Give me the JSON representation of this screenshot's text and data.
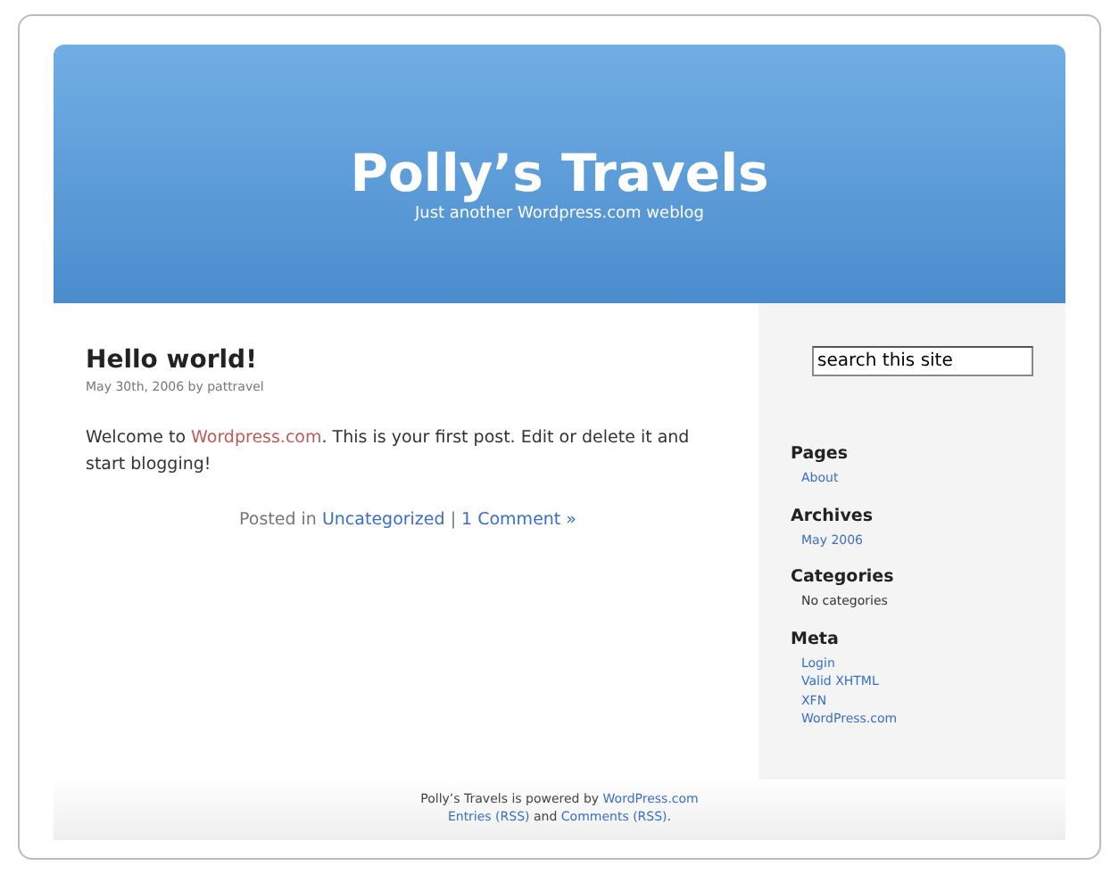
{
  "header": {
    "title": "Polly’s Travels",
    "tagline": "Just another Wordpress.com weblog"
  },
  "post": {
    "title": "Hello world!",
    "meta": "May 30th, 2006 by pattravel",
    "body": [
      {
        "text": "Welcome to ",
        "kind": "text"
      },
      {
        "text": "Wordpress.com",
        "kind": "link"
      },
      {
        "text": ". This is your first post. Edit or delete it and start blogging!",
        "kind": "text"
      }
    ],
    "footer": [
      {
        "text": "Posted in ",
        "kind": "text"
      },
      {
        "text": "Uncategorized",
        "kind": "link"
      },
      {
        "text": " | ",
        "kind": "text"
      },
      {
        "text": "1 Comment »",
        "kind": "link"
      }
    ]
  },
  "search": {
    "value": "search this site"
  },
  "sidebar": [
    {
      "heading": "Pages",
      "items": [
        {
          "text": "About",
          "kind": "link"
        }
      ]
    },
    {
      "heading": "Archives",
      "items": [
        {
          "text": "May 2006",
          "kind": "link"
        }
      ]
    },
    {
      "heading": "Categories",
      "items": [
        {
          "text": "No categories",
          "kind": "text"
        }
      ]
    },
    {
      "heading": "Meta",
      "items": [
        {
          "text": "Login",
          "kind": "link"
        },
        {
          "text": "Valid XHTML",
          "kind": "link"
        },
        {
          "text": "XFN",
          "kind": "link"
        },
        {
          "text": "WordPress.com",
          "kind": "link"
        }
      ]
    }
  ],
  "footer": [
    [
      {
        "text": "Polly’s Travels is powered by ",
        "kind": "text"
      },
      {
        "text": "WordPress.com",
        "kind": "link"
      }
    ],
    [
      {
        "text": "Entries (RSS)",
        "kind": "link"
      },
      {
        "text": " and ",
        "kind": "text"
      },
      {
        "text": "Comments (RSS)",
        "kind": "link"
      },
      {
        "text": ".",
        "kind": "text"
      }
    ]
  ]
}
